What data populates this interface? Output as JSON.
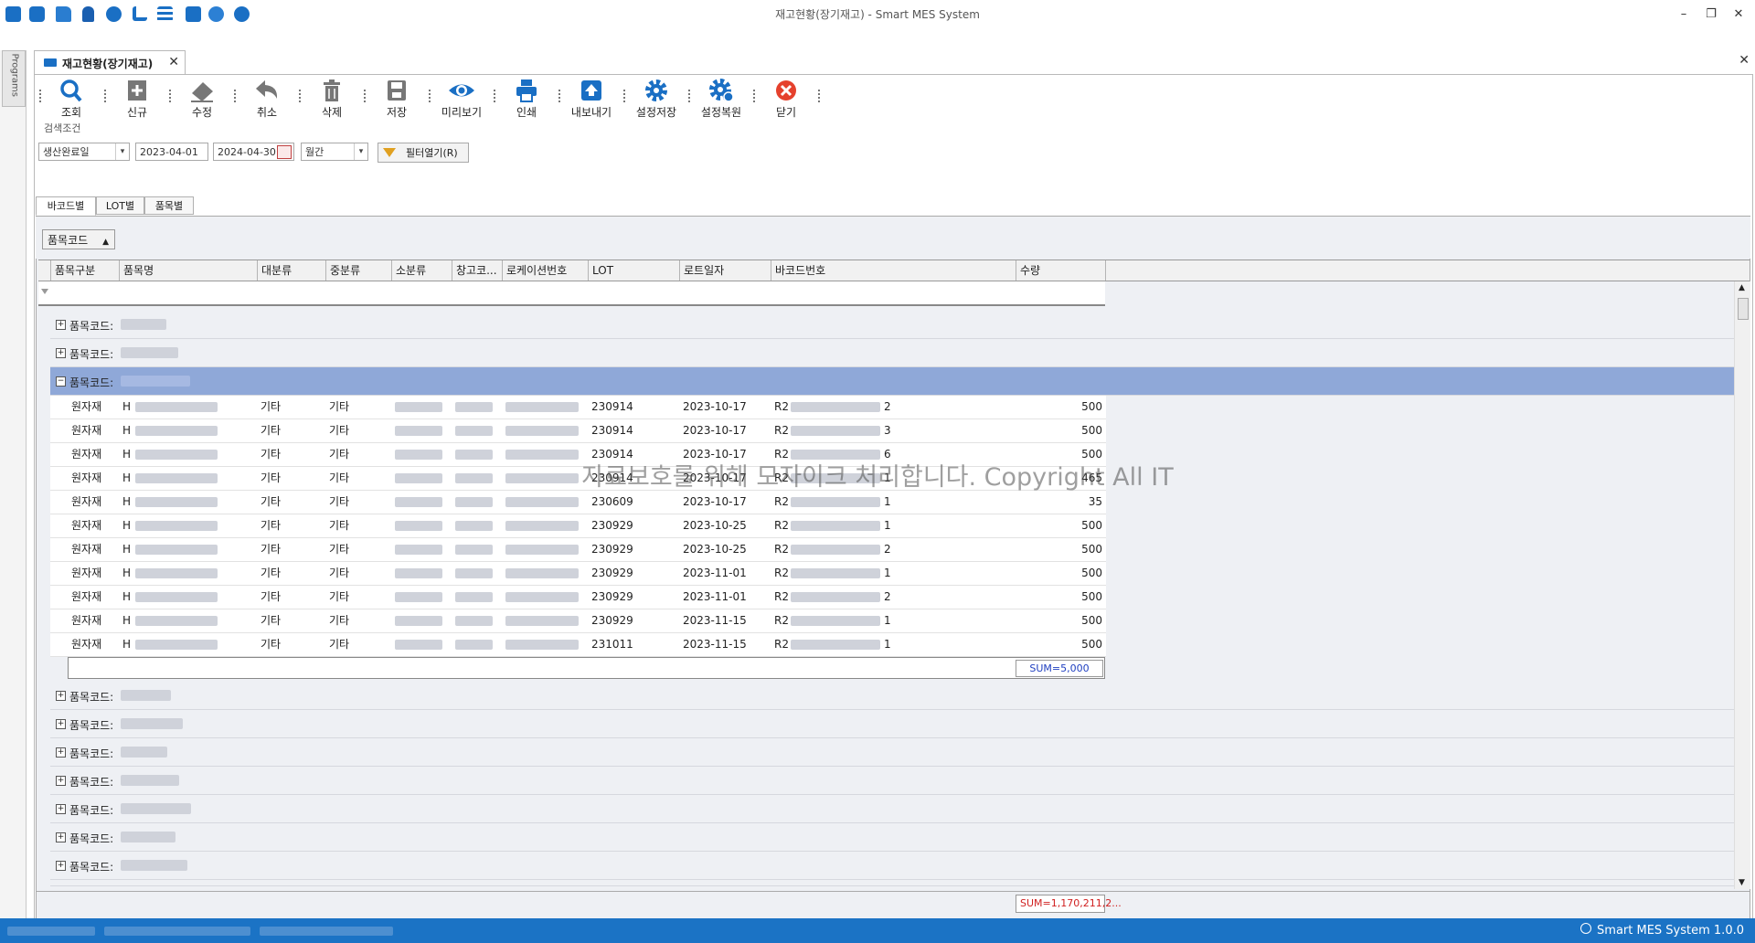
{
  "window": {
    "title": "재고현황(장기재고) - Smart MES System",
    "minimize": "–",
    "restore": "❐",
    "close": "✕"
  },
  "quick_access_icons": [
    "app-icon",
    "camera-icon",
    "folder-icon",
    "lock-icon",
    "plus-icon",
    "tree-icon",
    "list-icon",
    "window-icon",
    "palette-icon",
    "palette2-icon"
  ],
  "side": {
    "programs_label": "Programs"
  },
  "doc_tab": {
    "label": "재고현황(장기재고)",
    "close": "✕",
    "close_all": "✕"
  },
  "toolbar": {
    "query": "조회",
    "new": "신규",
    "edit": "수정",
    "cancel": "취소",
    "delete": "삭제",
    "save": "저장",
    "preview": "미리보기",
    "print": "인쇄",
    "export": "내보내기",
    "settings_save": "설정저장",
    "settings_restore": "설정복원",
    "close": "닫기"
  },
  "search": {
    "title": "검색조건",
    "date_type": "생산완료일",
    "date_from": "2023-04-01",
    "date_to": "2024-04-30",
    "period": "월간",
    "filter_button": "필터열기(R)"
  },
  "sub_tabs": [
    "바코드별",
    "LOT별",
    "품목별"
  ],
  "grid": {
    "group_chip": "품목코드",
    "columns": [
      "품목구분",
      "품목명",
      "대분류",
      "중분류",
      "소분류",
      "창고코...",
      "로케이션번호",
      "LOT",
      "로트일자",
      "바코드번호",
      "수량"
    ],
    "group_label": "품목코드:",
    "groups_before": 3,
    "rows": [
      {
        "type": "원자재",
        "name": "H",
        "major": "기타",
        "mid": "기타",
        "lot": "230914",
        "lot_date": "2023-10-17",
        "barcode_pre": "R2",
        "barcode_suf": "2",
        "qty": "500"
      },
      {
        "type": "원자재",
        "name": "H",
        "major": "기타",
        "mid": "기타",
        "lot": "230914",
        "lot_date": "2023-10-17",
        "barcode_pre": "R2",
        "barcode_suf": "3",
        "qty": "500"
      },
      {
        "type": "원자재",
        "name": "H",
        "major": "기타",
        "mid": "기타",
        "lot": "230914",
        "lot_date": "2023-10-17",
        "barcode_pre": "R2",
        "barcode_suf": "6",
        "qty": "500"
      },
      {
        "type": "원자재",
        "name": "H",
        "major": "기타",
        "mid": "기타",
        "lot": "230914",
        "lot_date": "2023-10-17",
        "barcode_pre": "R2",
        "barcode_suf": "1",
        "qty": "465"
      },
      {
        "type": "원자재",
        "name": "H",
        "major": "기타",
        "mid": "기타",
        "lot": "230609",
        "lot_date": "2023-10-17",
        "barcode_pre": "R2",
        "barcode_suf": "1",
        "qty": "35"
      },
      {
        "type": "원자재",
        "name": "H",
        "major": "기타",
        "mid": "기타",
        "lot": "230929",
        "lot_date": "2023-10-25",
        "barcode_pre": "R2",
        "barcode_suf": "1",
        "qty": "500"
      },
      {
        "type": "원자재",
        "name": "H",
        "major": "기타",
        "mid": "기타",
        "lot": "230929",
        "lot_date": "2023-10-25",
        "barcode_pre": "R2",
        "barcode_suf": "2",
        "qty": "500"
      },
      {
        "type": "원자재",
        "name": "H",
        "major": "기타",
        "mid": "기타",
        "lot": "230929",
        "lot_date": "2023-11-01",
        "barcode_pre": "R2",
        "barcode_suf": "1",
        "qty": "500"
      },
      {
        "type": "원자재",
        "name": "H",
        "major": "기타",
        "mid": "기타",
        "lot": "230929",
        "lot_date": "2023-11-01",
        "barcode_pre": "R2",
        "barcode_suf": "2",
        "qty": "500"
      },
      {
        "type": "원자재",
        "name": "H",
        "major": "기타",
        "mid": "기타",
        "lot": "230929",
        "lot_date": "2023-11-15",
        "barcode_pre": "R2",
        "barcode_suf": "1",
        "qty": "500"
      },
      {
        "type": "원자재",
        "name": "H",
        "major": "기타",
        "mid": "기타",
        "lot": "231011",
        "lot_date": "2023-11-15",
        "barcode_pre": "R2",
        "barcode_suf": "1",
        "qty": "500"
      }
    ],
    "groups_after": 8,
    "group_sum": "SUM=5,000",
    "total_sum": "SUM=1,170,211,2..."
  },
  "watermark": "자료보호를 위해 모자이크 처리합니다. Copyright All IT",
  "status": {
    "app_version": "Smart MES System 1.0.0"
  },
  "colors": {
    "selected_group": "#8fa8d8",
    "status_bar": "#1b73c5",
    "sum_total_text": "#d02020",
    "sum_group_text": "#2040c0",
    "close_red": "#e5412d",
    "toolbar_blue": "#1a6fc4"
  }
}
